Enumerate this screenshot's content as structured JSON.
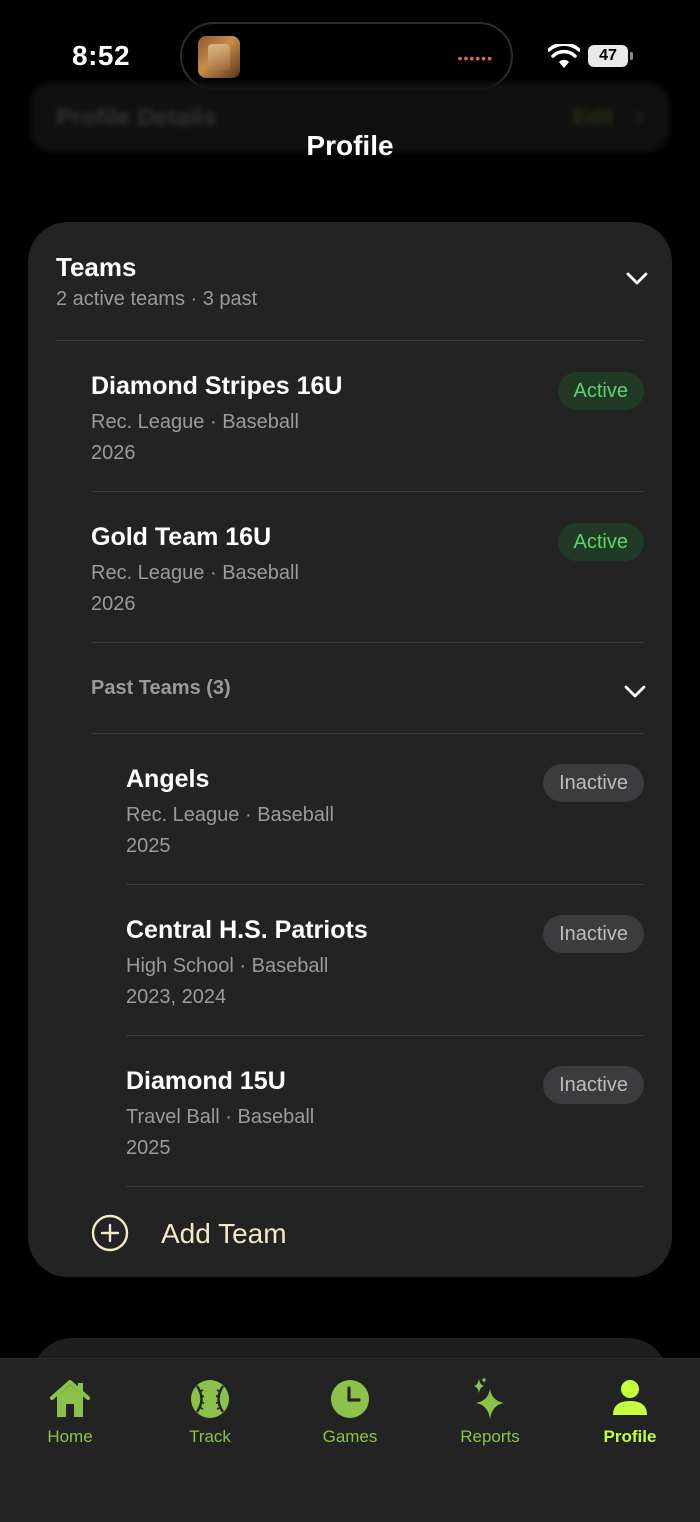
{
  "status_bar": {
    "time": "8:52",
    "battery": "47"
  },
  "background_header": {
    "title": "Profile Details",
    "action": "Edit"
  },
  "page": {
    "title": "Profile"
  },
  "teams_card": {
    "title": "Teams",
    "subtitle": "2 active teams · 3 past",
    "active_teams": [
      {
        "name": "Diamond Stripes 16U",
        "meta": "Rec. League · Baseball",
        "years": "2026",
        "status": "Active"
      },
      {
        "name": "Gold Team 16U",
        "meta": "Rec. League · Baseball",
        "years": "2026",
        "status": "Active"
      }
    ],
    "past_label": "Past Teams (3)",
    "past_teams": [
      {
        "name": "Angels",
        "meta": "Rec. League · Baseball",
        "years": "2025",
        "status": "Inactive"
      },
      {
        "name": "Central H.S. Patriots",
        "meta": "High School · Baseball",
        "years": "2023, 2024",
        "status": "Inactive"
      },
      {
        "name": "Diamond 15U",
        "meta": "Travel Ball · Baseball",
        "years": "2025",
        "status": "Inactive"
      }
    ],
    "add_label": "Add Team"
  },
  "tab_bar": {
    "items": [
      {
        "label": "Home",
        "icon": "home-icon"
      },
      {
        "label": "Track",
        "icon": "baseball-icon"
      },
      {
        "label": "Games",
        "icon": "clock-icon"
      },
      {
        "label": "Reports",
        "icon": "sparkles-icon"
      },
      {
        "label": "Profile",
        "icon": "person-icon",
        "active": true
      }
    ]
  },
  "colors": {
    "background": "#000000",
    "card": "#232323",
    "accent_green": "#8bc34a",
    "active_tab": "#c6ff3d",
    "active_badge_text": "#5fd36a",
    "add_label": "#f3e8c8"
  }
}
